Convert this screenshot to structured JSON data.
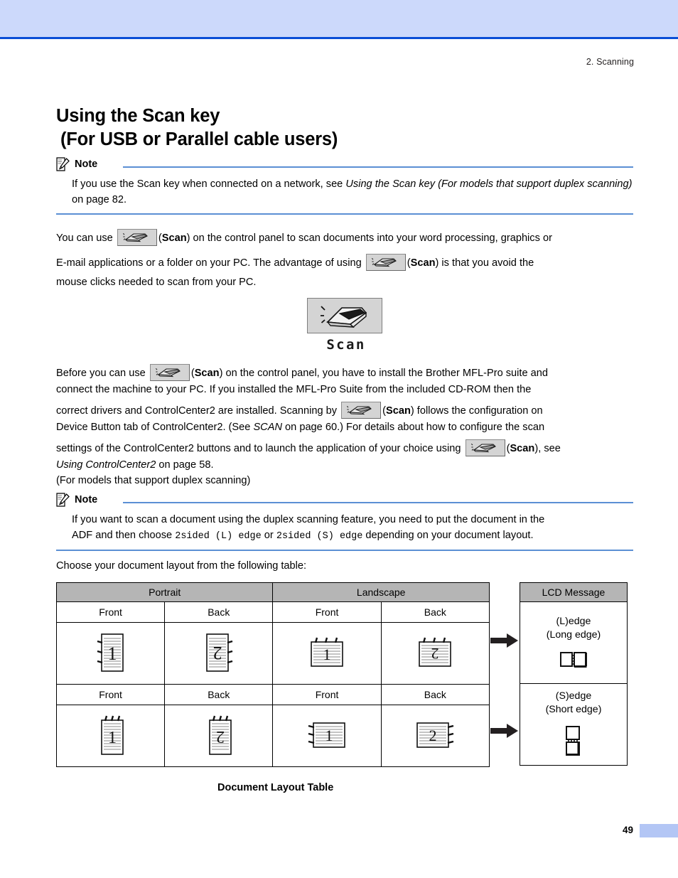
{
  "header": {
    "chapter": "2. Scanning",
    "band_color": "#ccd9fb",
    "rule_color": "#0a4ed6"
  },
  "title": {
    "line1": "Using the Scan key",
    "line2": "(For USB or Parallel cable users)"
  },
  "note1": {
    "label": "Note",
    "text_a": "If you use the Scan key when connected on a network, see ",
    "text_b_italic": "Using the Scan key (For models that support duplex scanning)",
    "text_c": " on page 82."
  },
  "para1": {
    "a": "You can use ",
    "b": "(",
    "scan_bold": "Scan",
    "c": ") on the control panel to scan documents into your word processing, graphics or"
  },
  "para2": {
    "a": "E-mail applications or a folder on your PC. The advantage of using ",
    "b": "(",
    "scan_bold": "Scan",
    "c": ") is that you avoid the",
    "d": "mouse clicks needed to scan from your PC."
  },
  "scan_figure": {
    "caption": "Scan",
    "icon": "scanner-icon",
    "button_face_color": "#d4d4d4"
  },
  "para3": {
    "a": "Before you can use ",
    "b": "(",
    "scan_bold": "Scan",
    "c": ") on the control panel, you have to install the Brother MFL-Pro suite and",
    "d": "connect the machine to your PC. If you installed the MFL-Pro Suite from the included CD-ROM then the"
  },
  "para4": {
    "a": "correct drivers and ControlCenter2 are installed. Scanning by ",
    "b": "(",
    "scan_bold": "Scan",
    "c": ") follows the configuration on",
    "d": "Device Button tab of ControlCenter2. (See ",
    "d_italic": "SCAN",
    "e": " on page 60.) For details about how to configure the scan"
  },
  "para5": {
    "a": "settings of the ControlCenter2 buttons and to launch the application of your choice using ",
    "b": "(",
    "scan_bold": "Scan",
    "c": "), see",
    "d_italic": "Using ControlCenter2",
    "e": " on page 58.",
    "f": "(For models that support duplex scanning)"
  },
  "note2": {
    "label": "Note",
    "line1": "If you want to scan a document using the duplex scanning feature, you need to put the document in the",
    "line2_a": "ADF and then choose ",
    "line2_mono1": "2sided (L) edge",
    "line2_b": " or ",
    "line2_mono2": "2sided (S) edge",
    "line2_c": " depending on your document layout."
  },
  "para6": {
    "text": "Choose your document layout from the following table:"
  },
  "table": {
    "headers": [
      "Portrait",
      "Landscape"
    ],
    "lcd_header": "LCD Message",
    "subheaders": [
      "Front",
      "Back",
      "Front",
      "Back"
    ],
    "rows": [
      {
        "subheaders": [
          "Front",
          "Back",
          "Front",
          "Back"
        ],
        "pages": [
          {
            "number": "1",
            "orientation": "portrait",
            "binding": "left",
            "flipped": false
          },
          {
            "number": "2",
            "orientation": "portrait",
            "binding": "right",
            "flipped": true
          },
          {
            "number": "1",
            "orientation": "landscape",
            "binding": "top",
            "flipped": false
          },
          {
            "number": "2",
            "orientation": "landscape",
            "binding": "top",
            "flipped": true
          }
        ],
        "lcd_line1": "(L)edge",
        "lcd_line2": "(Long edge)",
        "lcd_icon": "long-edge-binding-icon"
      },
      {
        "subheaders": [
          "Front",
          "Back",
          "Front",
          "Back"
        ],
        "pages": [
          {
            "number": "1",
            "orientation": "portrait",
            "binding": "top",
            "flipped": false
          },
          {
            "number": "2",
            "orientation": "portrait",
            "binding": "top",
            "flipped": true
          },
          {
            "number": "1",
            "orientation": "landscape",
            "binding": "left",
            "flipped": false
          },
          {
            "number": "2",
            "orientation": "landscape",
            "binding": "right",
            "flipped": false
          }
        ],
        "lcd_line1": "(S)edge",
        "lcd_line2": "(Short edge)",
        "lcd_icon": "short-edge-binding-icon"
      }
    ],
    "header_fill": "#b5b5b5"
  },
  "caption": "Document Layout Table",
  "footer": {
    "page_number": "49",
    "block_color": "#b3c6f5"
  }
}
